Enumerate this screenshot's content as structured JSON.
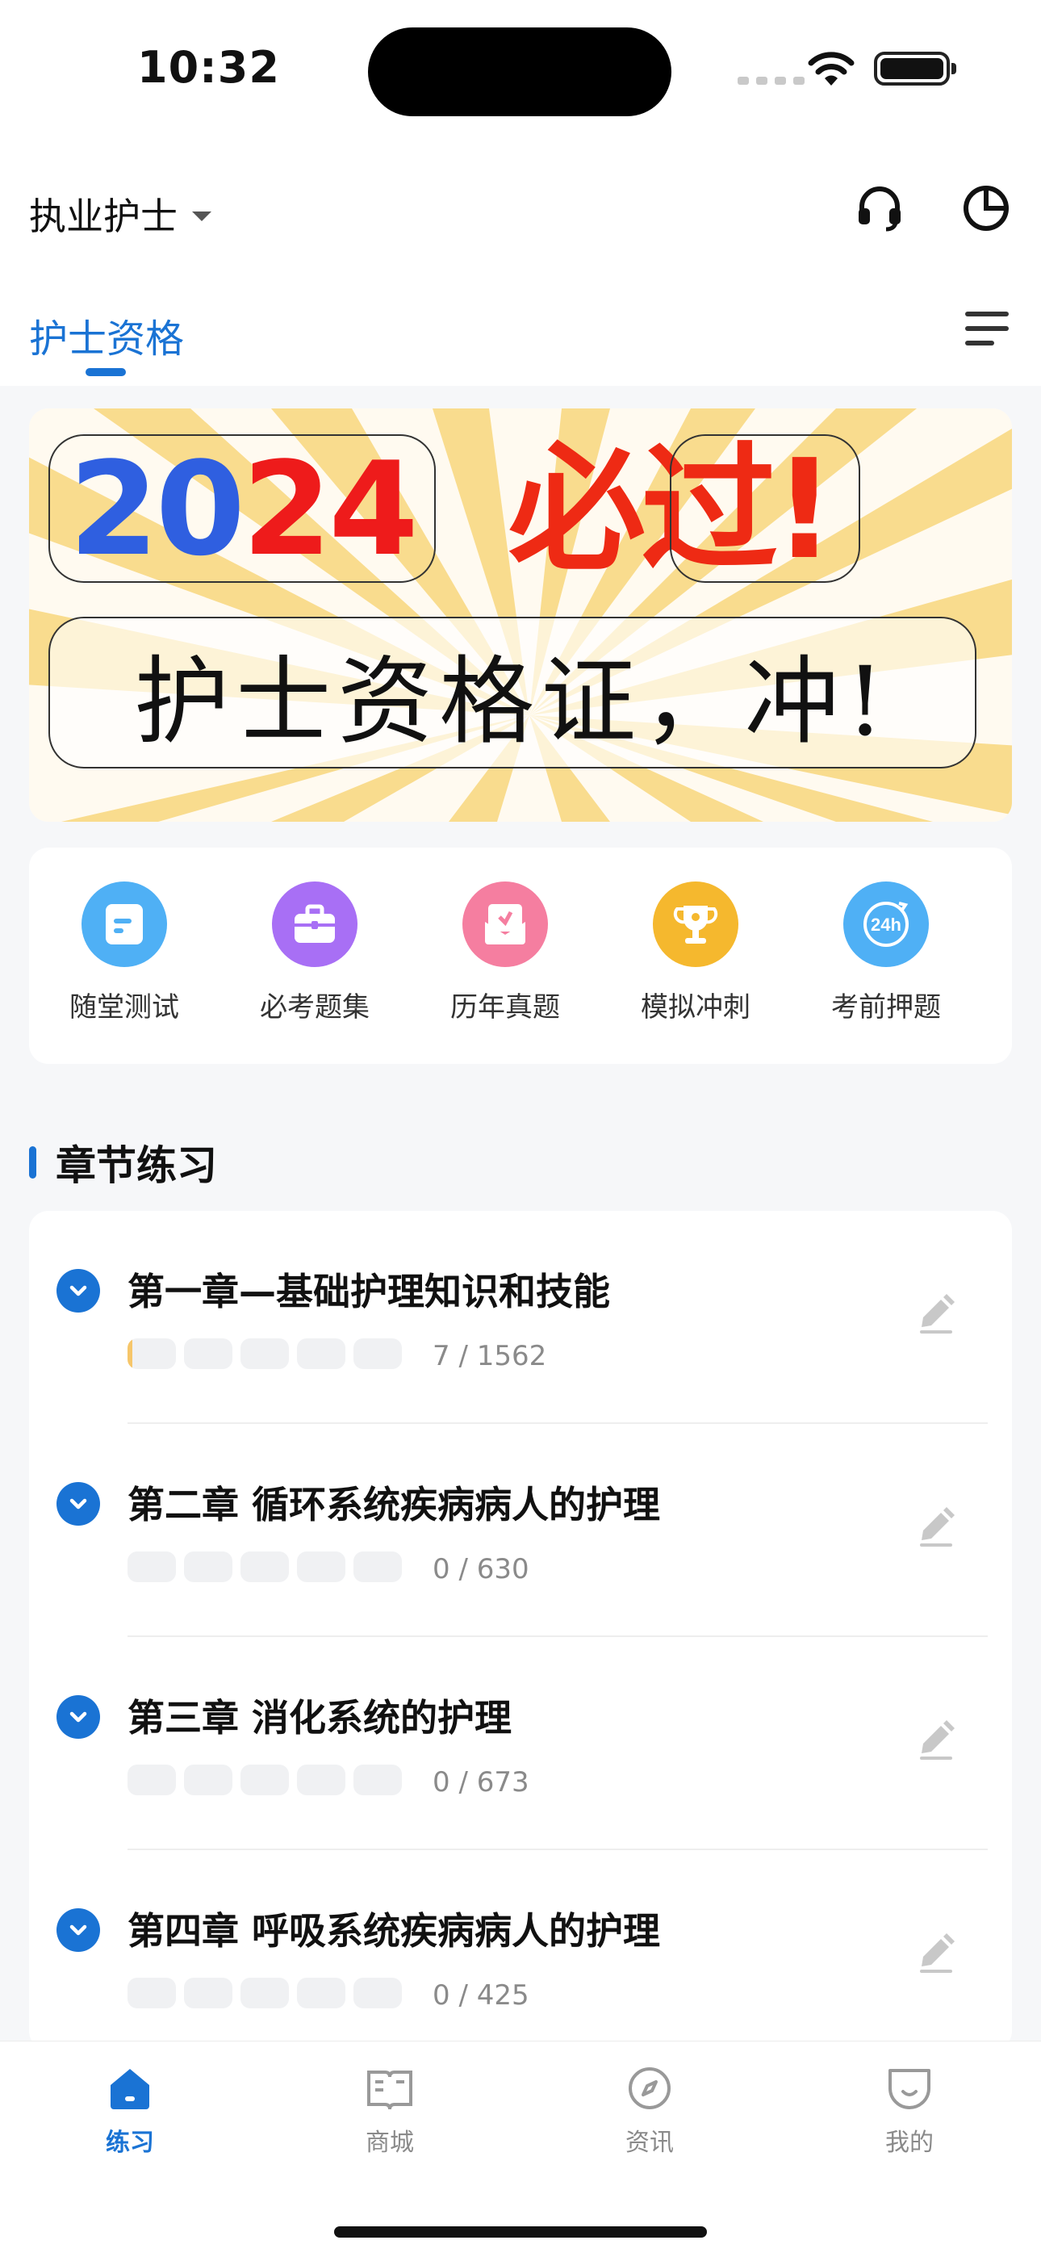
{
  "status_bar": {
    "time": "10:32"
  },
  "header": {
    "title": "执业护士",
    "active_tab": "护士资格"
  },
  "banner": {
    "year_part_a": "20",
    "year_part_b": "24",
    "headline": "必过!",
    "slogan": "护士资格证，冲!"
  },
  "quick_actions": [
    {
      "label": "随堂测试",
      "icon": "document-icon",
      "color": "#4fb0f5"
    },
    {
      "label": "必考题集",
      "icon": "briefcase-icon",
      "color": "#a86ff5"
    },
    {
      "label": "历年真题",
      "icon": "mail-open-icon",
      "color": "#f57ea0"
    },
    {
      "label": "模拟冲刺",
      "icon": "trophy-icon",
      "color": "#f5b82e"
    },
    {
      "label": "考前押题",
      "icon": "clock-24h-icon",
      "color": "#4fb0f5"
    }
  ],
  "section": {
    "title": "章节练习"
  },
  "chapters": [
    {
      "title": "第一章—基础护理知识和技能",
      "count": "7 / 1562",
      "progress": 0.0045
    },
    {
      "title": "第二章  循环系统疾病病人的护理",
      "count": "0 / 630",
      "progress": 0
    },
    {
      "title": "第三章 消化系统的护理",
      "count": "0 / 673",
      "progress": 0
    },
    {
      "title": "第四章 呼吸系统疾病病人的护理",
      "count": "0 / 425",
      "progress": 0
    }
  ],
  "tabbar": {
    "items": [
      {
        "label": "练习",
        "icon": "home-icon",
        "active": true
      },
      {
        "label": "商城",
        "icon": "book-open-icon",
        "active": false
      },
      {
        "label": "资讯",
        "icon": "compass-icon",
        "active": false
      },
      {
        "label": "我的",
        "icon": "smile-icon",
        "active": false
      }
    ]
  },
  "colors": {
    "accent": "#1a73d4",
    "banner_red": "#ee2a14",
    "banner_blue": "#2f5fe0",
    "ray_yellow": "#f9dc8e"
  }
}
